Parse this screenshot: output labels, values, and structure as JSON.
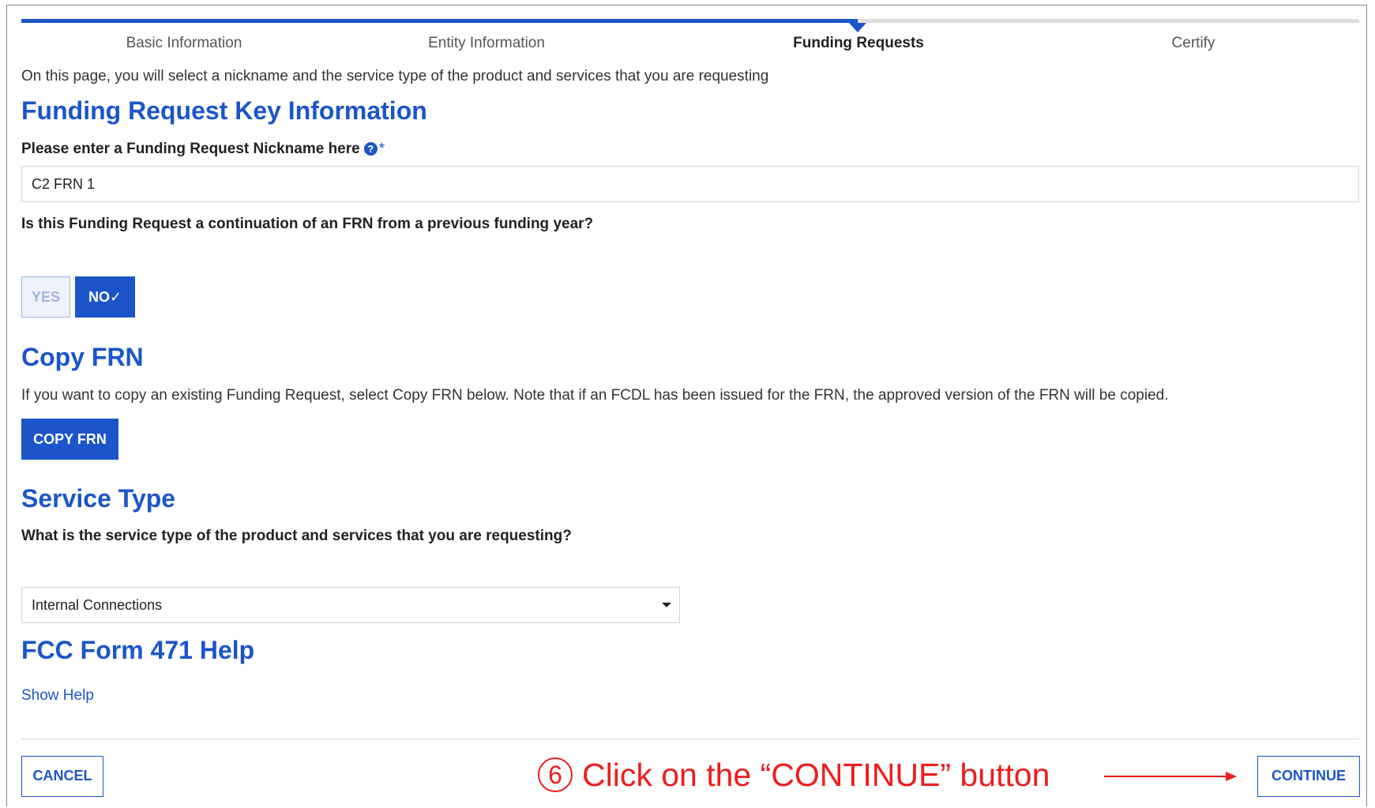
{
  "steps": [
    {
      "label": "Basic Information",
      "active": false
    },
    {
      "label": "Entity Information",
      "active": false
    },
    {
      "label": "Funding Requests",
      "active": true
    },
    {
      "label": "Certify",
      "active": false
    }
  ],
  "progress": {
    "completed_steps": 3,
    "total_steps": 4
  },
  "intro_text": "On this page, you will select a nickname and the service type of the product and services that you are requesting",
  "key_info": {
    "heading": "Funding Request Key Information",
    "nickname_label": "Please enter a Funding Request Nickname here",
    "help_glyph": "?",
    "required_mark": "*",
    "nickname_value": "C2 FRN 1",
    "continuation_question": "Is this Funding Request a continuation of an FRN from a previous funding year?",
    "yes_label": "YES",
    "no_label": "NO✓",
    "selected": "NO"
  },
  "copy_frn": {
    "heading": "Copy FRN",
    "description": "If you want to copy an existing Funding Request, select Copy FRN below. Note that if an FCDL has been issued for the FRN, the approved version of the FRN will be copied.",
    "button_label": "COPY FRN"
  },
  "service_type": {
    "heading": "Service Type",
    "question": "What is the service type of the product and services that you are requesting?",
    "selected_value": "Internal Connections"
  },
  "help": {
    "heading": "FCC Form 471 Help",
    "link_label": "Show Help"
  },
  "footer": {
    "cancel_label": "CANCEL",
    "continue_label": "CONTINUE"
  },
  "annotation": {
    "number": "6",
    "text": "Click on the “CONTINUE” button",
    "color": "#ee1c1c"
  },
  "colors": {
    "primary": "#1b55c9",
    "track": "#dedede"
  },
  "icons": {
    "help": "question-circle-icon",
    "select_caret": "caret-down-icon",
    "annotation_arrow": "arrow-right-icon"
  }
}
